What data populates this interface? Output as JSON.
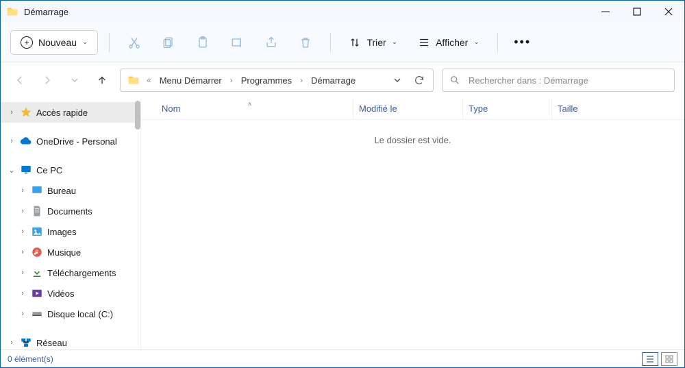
{
  "window": {
    "title": "Démarrage"
  },
  "toolbar": {
    "new_label": "Nouveau",
    "sort_label": "Trier",
    "view_label": "Afficher"
  },
  "breadcrumbs": {
    "items": [
      "Menu Démarrer",
      "Programmes",
      "Démarrage"
    ]
  },
  "search": {
    "placeholder": "Rechercher dans : Démarrage"
  },
  "sidebar": {
    "quick_access": "Accès rapide",
    "onedrive": "OneDrive - Personal",
    "this_pc": "Ce PC",
    "desktop": "Bureau",
    "documents": "Documents",
    "pictures": "Images",
    "music": "Musique",
    "downloads": "Téléchargements",
    "videos": "Vidéos",
    "local_disk": "Disque local (C:)",
    "network": "Réseau"
  },
  "columns": {
    "name": "Nom",
    "modified": "Modifié le",
    "type": "Type",
    "size": "Taille"
  },
  "content": {
    "empty_message": "Le dossier est vide."
  },
  "status": {
    "items_text": "0 élément(s)"
  }
}
